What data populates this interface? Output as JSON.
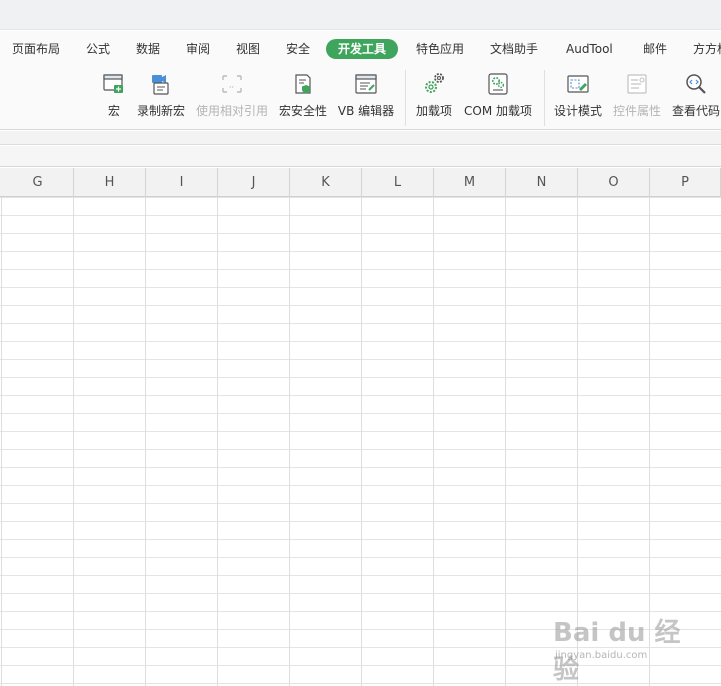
{
  "tabs": [
    {
      "label": "页面布局"
    },
    {
      "label": "公式"
    },
    {
      "label": "数据"
    },
    {
      "label": "审阅"
    },
    {
      "label": "视图"
    },
    {
      "label": "安全"
    },
    {
      "label": "开发工具",
      "active": true
    },
    {
      "label": "特色应用"
    },
    {
      "label": "文档助手"
    },
    {
      "label": "AudTool"
    },
    {
      "label": "邮件"
    },
    {
      "label": "方方格"
    }
  ],
  "ribbon": {
    "macro": "宏",
    "record_macro": "录制新宏",
    "relative_ref": "使用相对引用",
    "macro_security": "宏安全性",
    "vb_editor": "VB 编辑器",
    "addins": "加载项",
    "com_addins": "COM 加载项",
    "design_mode": "设计模式",
    "control_props": "控件属性",
    "view_code": "查看代码"
  },
  "columns": [
    "G",
    "H",
    "I",
    "J",
    "K",
    "L",
    "M",
    "N",
    "O",
    "P"
  ],
  "watermark": {
    "text": "Bai du 经验",
    "url": "jingyan.baidu.com"
  },
  "colors": {
    "accent": "#3fa55c",
    "disabled_text": "#b4b4b4"
  }
}
